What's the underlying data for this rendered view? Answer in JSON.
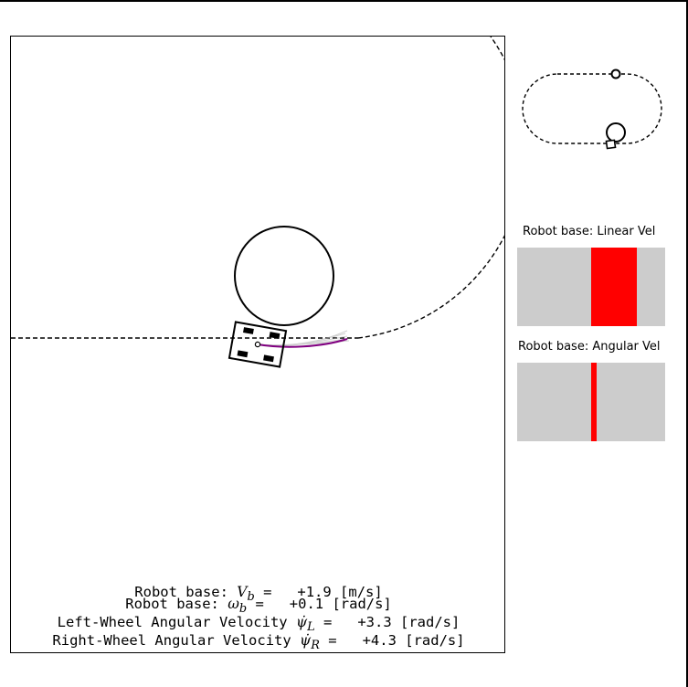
{
  "readouts": {
    "linear_prefix": "Robot base: ",
    "linear_symbol": "V",
    "linear_sub": "b",
    "linear_value": " =   +1.9 [m/s]",
    "angular_prefix": "Robot base: ",
    "angular_symbol": "ω",
    "angular_sub": "b",
    "angular_value": " =   +0.1 [rad/s]",
    "left_prefix": "Left-Wheel Angular Velocity ",
    "left_symbol": "ψ̇",
    "left_sub": "L",
    "left_value": " =   +3.3 [rad/s]",
    "right_prefix": "Right-Wheel Angular Velocity ",
    "right_symbol": "ψ̇",
    "right_sub": "R",
    "right_value": " =   +4.3 [rad/s]"
  },
  "gauges": {
    "linear": {
      "title": "Robot base: Linear Vel",
      "fill_start": 0.5,
      "fill_end": 0.81
    },
    "angular": {
      "title": "Robot base: Angular Vel",
      "fill_start": 0.5,
      "fill_end": 0.54
    }
  },
  "colors": {
    "gauge_background": "#cccccc",
    "gauge_fill": "#ff0000",
    "trajectory": "#800080",
    "prediction": "#aaaaaa",
    "track": "#000000"
  }
}
